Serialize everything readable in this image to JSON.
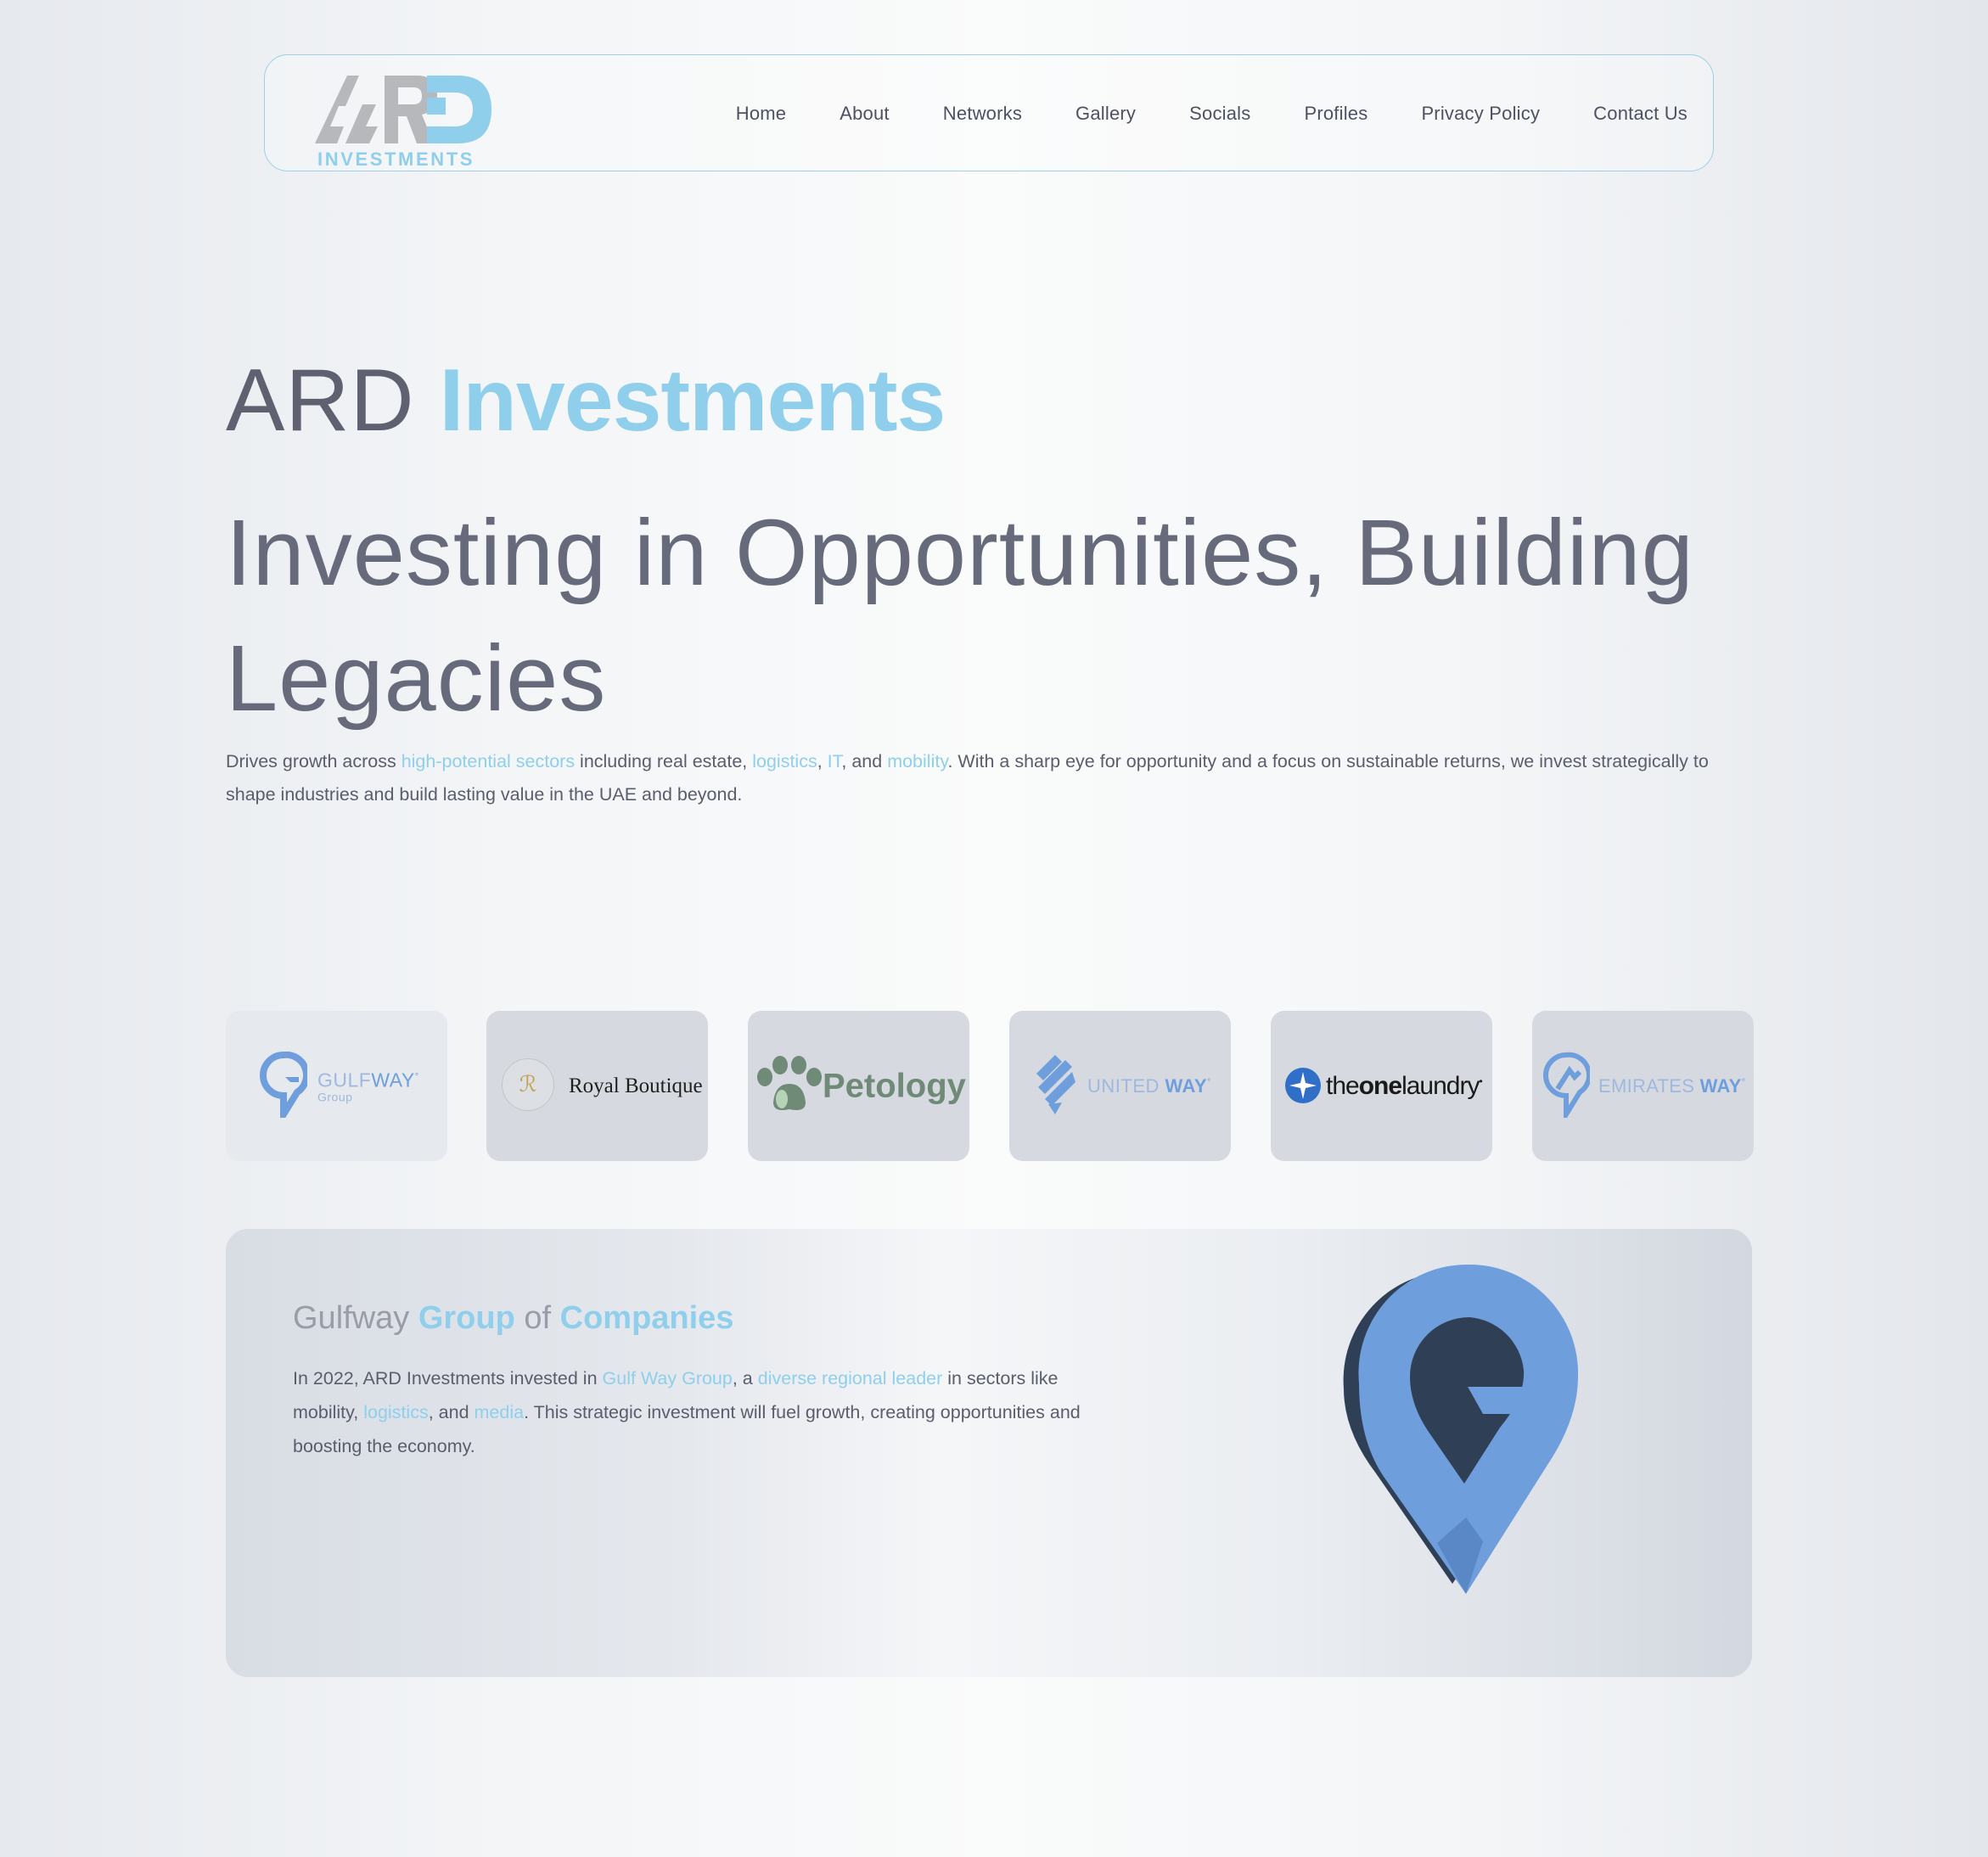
{
  "nav": {
    "logo_text": "ARD",
    "logo_sub": "INVESTMENTS",
    "links": [
      "Home",
      "About",
      "Networks",
      "Gallery",
      "Socials",
      "Profiles",
      "Privacy Policy",
      "Contact Us"
    ]
  },
  "hero": {
    "title_light": "ARD",
    "title_bold": "Investments",
    "subtitle": "Investing in Opportunities, Building Legacies",
    "desc": {
      "p1": "Drives growth across ",
      "h1": "high-potential sectors",
      "p2": " including real estate, ",
      "h2": "logistics",
      "p3": ", ",
      "h3": "IT",
      "p4": ", and ",
      "h4": "mobility",
      "p5": ". With a sharp eye for opportunity and a focus on sustainable returns, we invest strategically to shape industries and build lasting value in the UAE and beyond."
    }
  },
  "partners": [
    {
      "name_a": "GULF",
      "name_b": "WAY",
      "tm": "°",
      "sub": "Group"
    },
    {
      "name": "Royal Boutique",
      "monogram": "ℛ"
    },
    {
      "name": "Petology"
    },
    {
      "name_a": "UNITED ",
      "name_b": "WAY",
      "tm": "°"
    },
    {
      "name_a": "the",
      "name_b": "one",
      "name_c": "laundry",
      "tm": "•"
    },
    {
      "name_a": "EMIRATES ",
      "name_b": "WAY",
      "tm": "°"
    }
  ],
  "feature": {
    "t1": "Gulfway ",
    "t2": "Group",
    "t3": " of ",
    "t4": "Companies",
    "desc": {
      "p1": "In 2022, ARD Investments invested in ",
      "h1": "Gulf Way Group",
      "p2": ", a ",
      "h2": "diverse regional leader",
      "p3": " in sectors like mobility, ",
      "h3": "logistics",
      "p4": ", and ",
      "h4": "media",
      "p5": ". This strategic investment will fuel growth, creating opportunities and boosting the economy."
    }
  },
  "colors": {
    "accent": "#8fcfec",
    "brand_blue": "#6f9edc",
    "text": "#5f6272",
    "card": "#d6dae0"
  },
  "icons": [
    "ard-logo-icon",
    "gulfway-pin-icon",
    "royal-boutique-monogram-icon",
    "paw-icon",
    "united-way-icon",
    "star-icon",
    "emirates-way-pin-icon",
    "gulfway-3d-pin-icon"
  ]
}
